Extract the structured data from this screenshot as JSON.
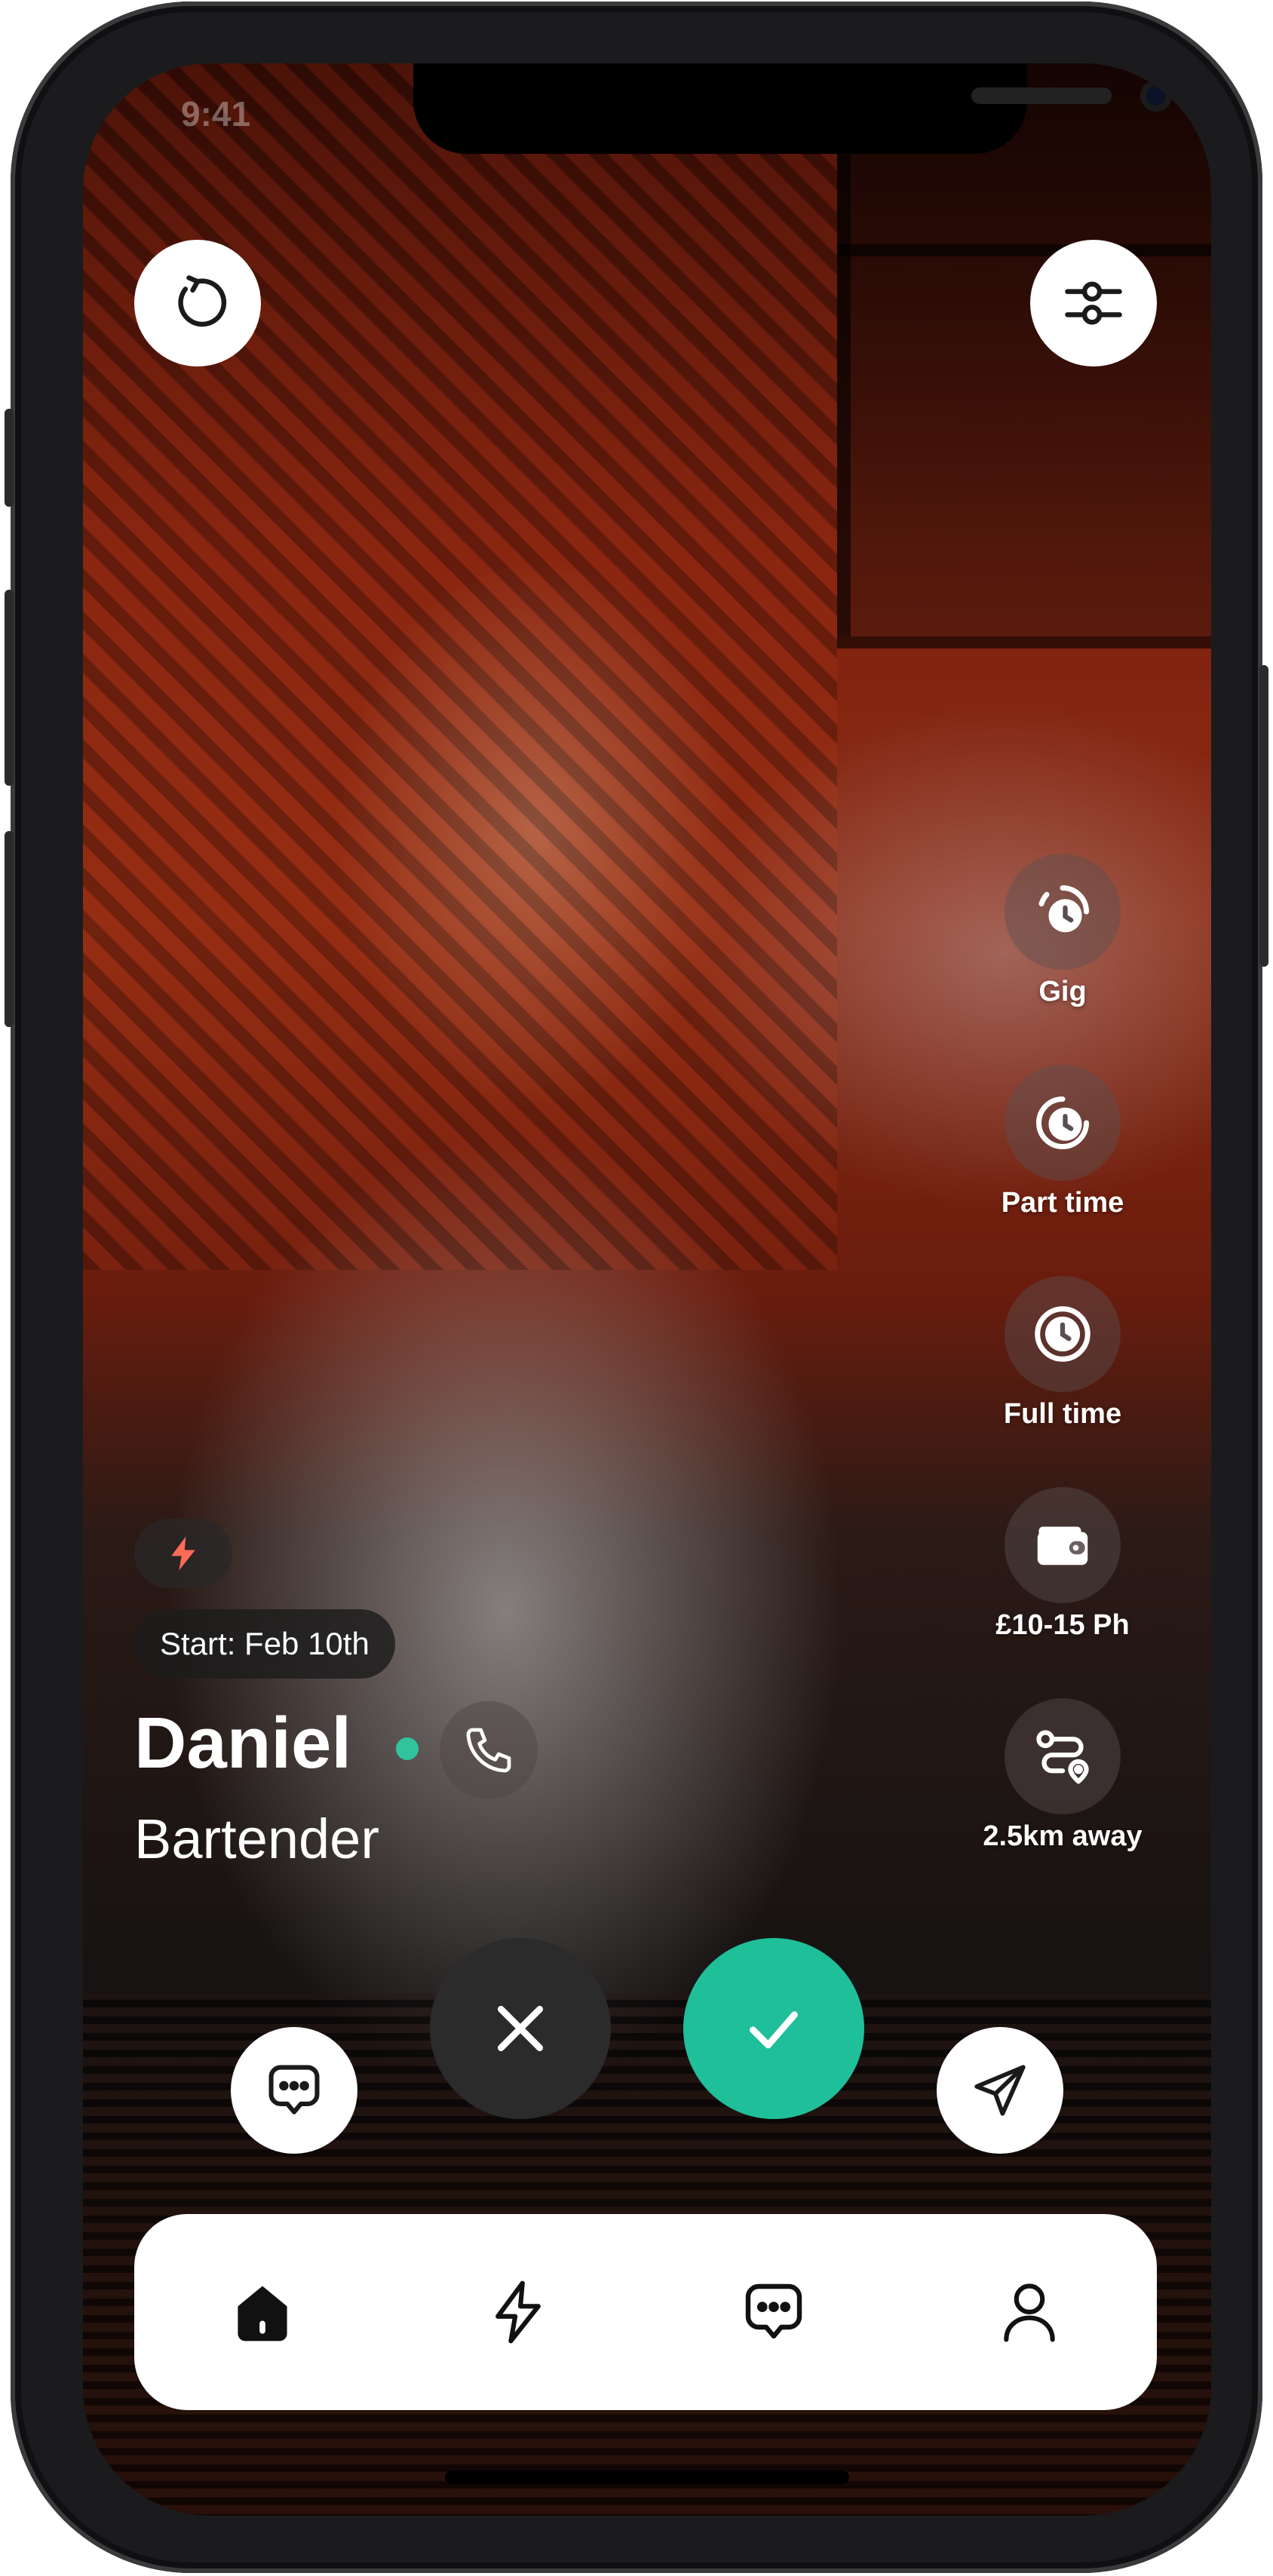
{
  "status_bar": {
    "time": "9:41"
  },
  "top_controls": {
    "undo_icon": "undo-icon",
    "filters_icon": "sliders-icon"
  },
  "features": [
    {
      "label": "Gig",
      "icon": "clock-quarter-icon"
    },
    {
      "label": "Part time",
      "icon": "clock-half-icon"
    },
    {
      "label": "Full time",
      "icon": "clock-full-icon"
    },
    {
      "label": "£10-15 Ph",
      "icon": "wallet-icon"
    },
    {
      "label": "2.5km away",
      "icon": "route-icon"
    }
  ],
  "profile": {
    "start_label": "Start: Feb 10th",
    "name": "Daniel",
    "role": "Bartender",
    "online": true,
    "online_color": "#30c39e",
    "bolt_color": "#ff6b57"
  },
  "actions": [
    {
      "name": "message",
      "icon": "chat-icon"
    },
    {
      "name": "reject",
      "icon": "close-icon"
    },
    {
      "name": "accept",
      "icon": "check-icon"
    },
    {
      "name": "send",
      "icon": "send-icon"
    }
  ],
  "colors": {
    "accent": "#1fbf9a",
    "reject": "#2b2b2b"
  },
  "tab_bar": [
    {
      "name": "home",
      "icon": "home-icon",
      "active": true
    },
    {
      "name": "boost",
      "icon": "bolt-icon",
      "active": false
    },
    {
      "name": "messages",
      "icon": "chat-icon",
      "active": false
    },
    {
      "name": "profile",
      "icon": "user-icon",
      "active": false
    }
  ]
}
